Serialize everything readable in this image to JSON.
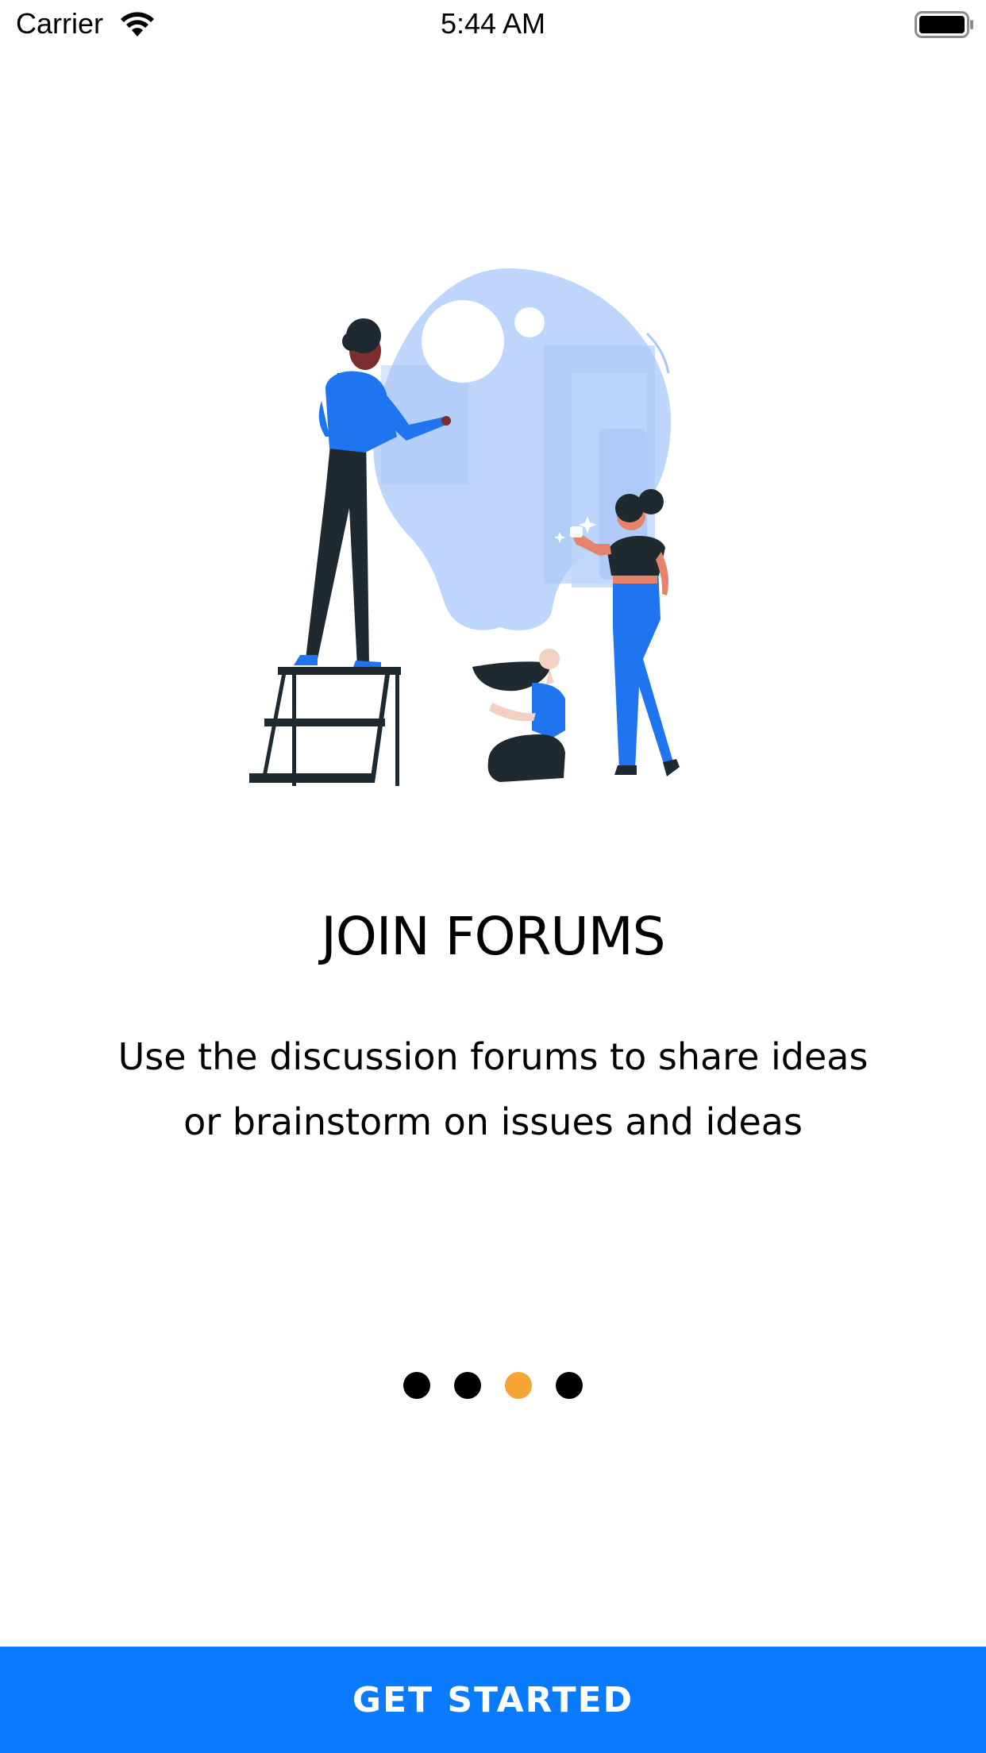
{
  "status_bar": {
    "carrier": "Carrier",
    "time": "5:44 AM",
    "icons": [
      "wifi-icon",
      "battery-icon"
    ]
  },
  "onboarding": {
    "illustration": "people-brainstorming-lightbulb-illustration",
    "title": "JOIN FORUMS",
    "description": "Use the discussion forums to share ideas or brainstorm on issues and ideas",
    "page_count": 4,
    "current_page": 3
  },
  "actions": {
    "get_started_label": "GET STARTED"
  },
  "colors": {
    "primary": "#0A7AFF",
    "active_dot": "#F5A436",
    "inactive_dot": "#000000",
    "illustration_blue": "#BED6FB",
    "figure_blue": "#1F74F0",
    "figure_dark": "#1E2A30"
  }
}
